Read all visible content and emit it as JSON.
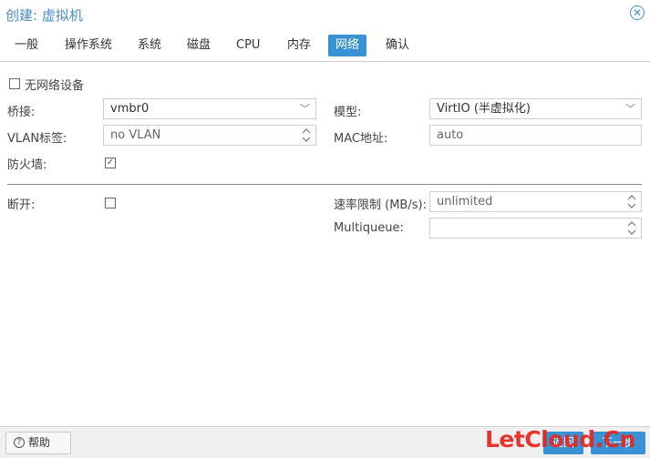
{
  "window": {
    "title": "创建: 虚拟机",
    "close_icon": "close-icon"
  },
  "tabs": [
    {
      "label": "一般",
      "active": false
    },
    {
      "label": "操作系统",
      "active": false
    },
    {
      "label": "系统",
      "active": false
    },
    {
      "label": "磁盘",
      "active": false
    },
    {
      "label": "CPU",
      "active": false
    },
    {
      "label": "内存",
      "active": false
    },
    {
      "label": "网络",
      "active": true
    },
    {
      "label": "确认",
      "active": false
    }
  ],
  "form": {
    "no_network_label": "无网络设备",
    "no_network_checked": false,
    "bridge_label": "桥接:",
    "bridge_value": "vmbr0",
    "model_label": "模型:",
    "model_value": "VirtIO (半虚拟化)",
    "vlan_label": "VLAN标签:",
    "vlan_value": "no VLAN",
    "mac_label": "MAC地址:",
    "mac_value": "auto",
    "firewall_label": "防火墙:",
    "firewall_checked": true,
    "disconnect_label": "断开:",
    "disconnect_checked": false,
    "rate_label": "速率限制 (MB/s):",
    "rate_value": "unlimited",
    "multiqueue_label": "Multiqueue:",
    "multiqueue_value": ""
  },
  "footer": {
    "help_label": "帮助",
    "back_label": "返回",
    "next_label": "下一步"
  },
  "watermark": "LetCloud.Cn",
  "colors": {
    "accent": "#3892d4",
    "title": "#4a8ec4",
    "watermark": "#e8251e"
  }
}
